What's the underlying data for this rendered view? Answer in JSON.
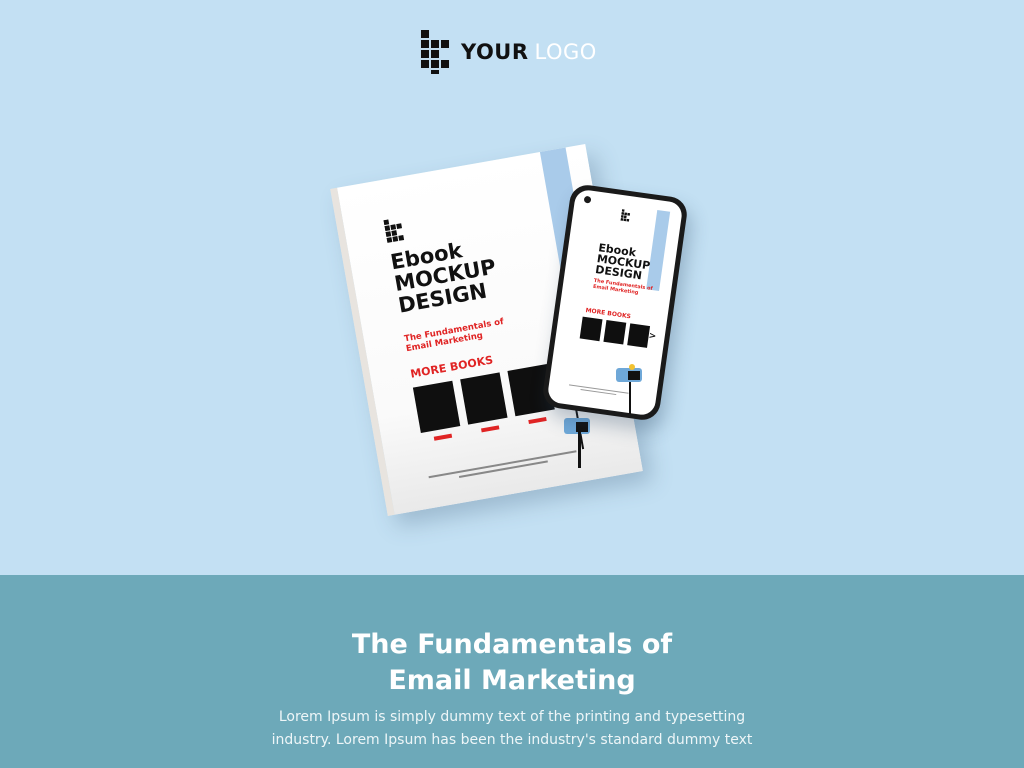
{
  "logo": {
    "word1": "YOUR",
    "word2": "LOGO",
    "icon": "grid-squares-logo-icon"
  },
  "ebook": {
    "title_line1": "Ebook",
    "title_line2": "MOCKUP",
    "title_line3": "DESIGN",
    "subtitle_line1": "The Fundamentals of",
    "subtitle_line2": "Email Marketing",
    "more_books": "MORE BOOKS"
  },
  "phone": {
    "title_line1": "Ebook",
    "title_line2": "MOCKUP",
    "title_line3": "DESIGN",
    "subtitle_line1": "The Fundamentals of",
    "subtitle_line2": "Email Marketing",
    "more_books": "MORE BOOKS",
    "next_glyph": ">"
  },
  "content": {
    "title_line1": "The Fundamentals of",
    "title_line2": "Email Marketing",
    "body_line1": "Lorem Ipsum is simply dummy text of the printing and typesetting",
    "body_line2": "industry. Lorem Ipsum has been the industry's standard dummy text"
  },
  "colors": {
    "background": "#c3e0f3",
    "band": "#6da9b9",
    "accent_red": "#e02424",
    "stripe_blue": "#a9cbea"
  }
}
